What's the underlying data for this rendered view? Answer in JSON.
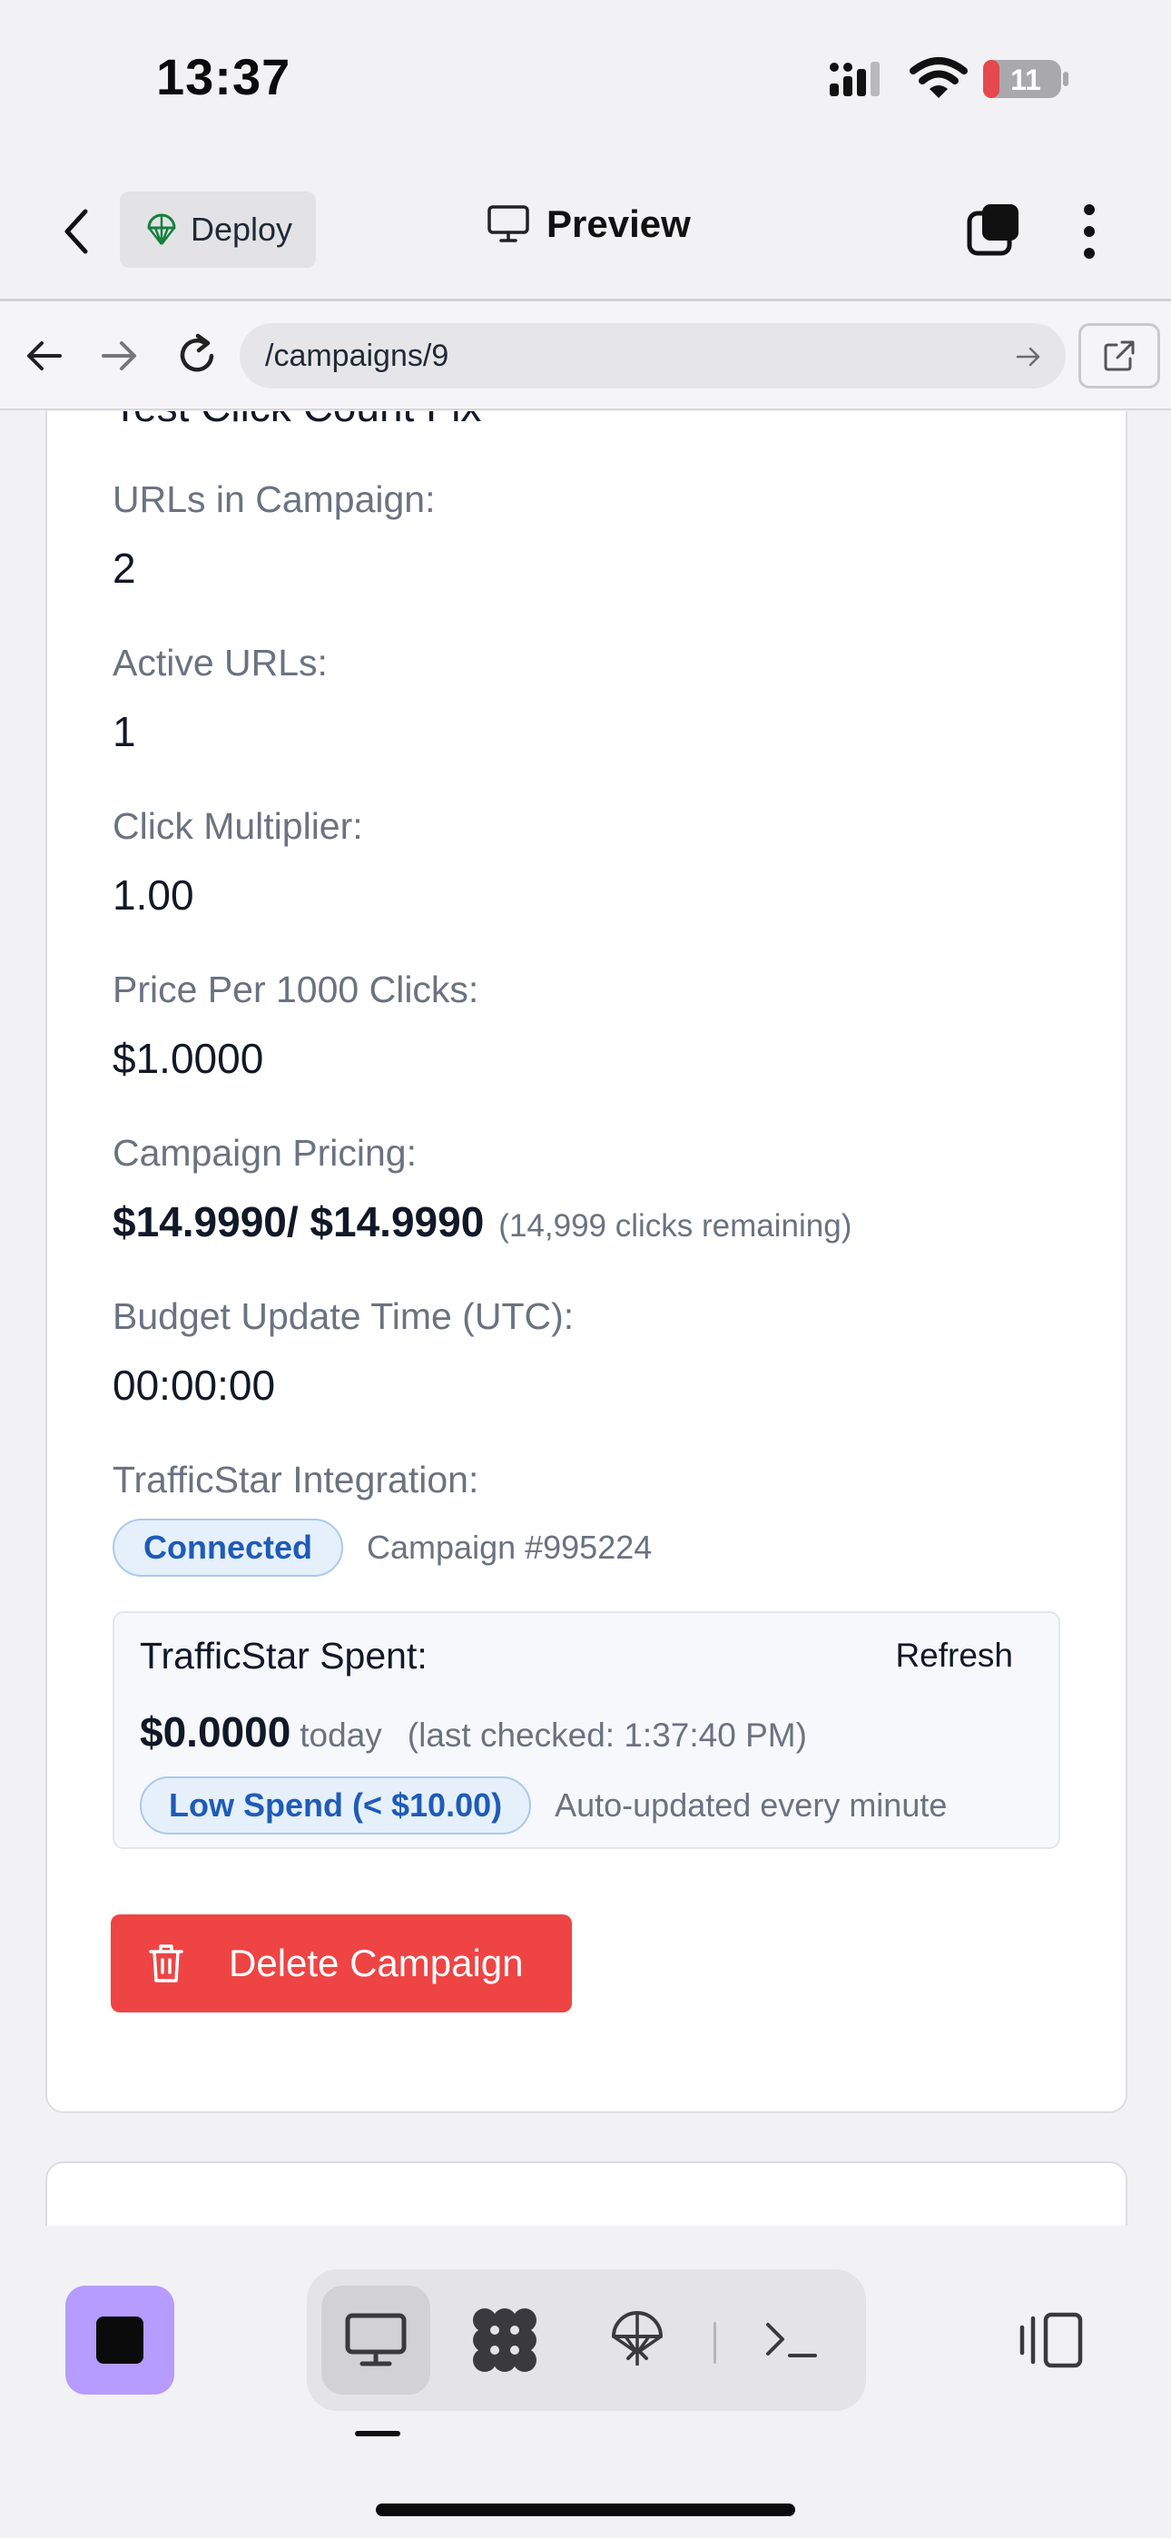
{
  "status_bar": {
    "time": "13:37",
    "battery_level": "11"
  },
  "toolbar": {
    "deploy_label": "Deploy",
    "preview_label": "Preview"
  },
  "browser": {
    "url": "/campaigns/9"
  },
  "campaign": {
    "name": "Test Click Count Fix",
    "fields": [
      {
        "label": "URLs in Campaign:",
        "value": "2"
      },
      {
        "label": "Active URLs:",
        "value": "1"
      },
      {
        "label": "Click Multiplier:",
        "value": "1.00"
      },
      {
        "label": "Price Per 1000 Clicks:",
        "value": "$1.0000"
      },
      {
        "label": "Campaign Pricing:",
        "value": "$14.9990/ $14.9990"
      },
      {
        "label": "Budget Update Time (UTC):",
        "value": "00:00:00"
      },
      {
        "label": "TrafficStar Integration:",
        "value": ""
      }
    ],
    "pricing_remaining": "(14,999 clicks remaining)",
    "trafficstar": {
      "status_badge": "Connected",
      "campaign_ref": "Campaign #995224",
      "spent_title": "TrafficStar Spent:",
      "refresh_label": "Refresh",
      "spent_amount": "$0.0000",
      "spent_period": "today",
      "last_checked": "(last checked: 1:37:40 PM)",
      "spend_level_badge": "Low Spend (< $10.00)",
      "auto_update_note": "Auto-updated every minute"
    },
    "delete_label": "Delete Campaign"
  },
  "colors": {
    "accent_purple": "#b69cff",
    "danger_red": "#ef4444",
    "badge_blue": "#1e5bb8"
  }
}
